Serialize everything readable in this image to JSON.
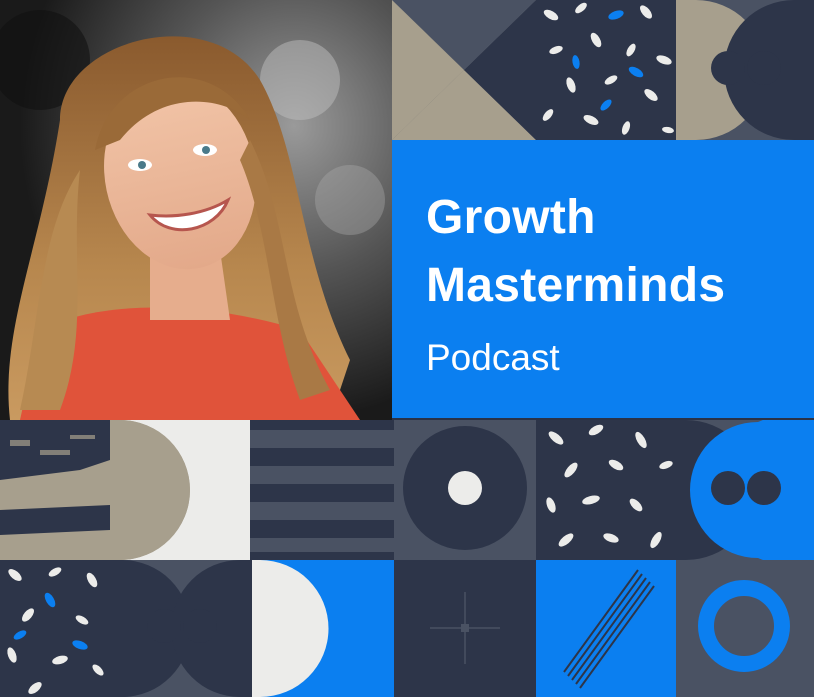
{
  "title": {
    "line1": "Growth",
    "line2": "Masterminds",
    "subtitle": "Podcast"
  },
  "colors": {
    "navy": "#2d3549",
    "slate": "#4a5263",
    "beige": "#a79f8d",
    "cream": "#ececea",
    "blue": "#0b7ff0",
    "white": "#ffffff"
  },
  "image": {
    "subject": "portrait-photo"
  }
}
